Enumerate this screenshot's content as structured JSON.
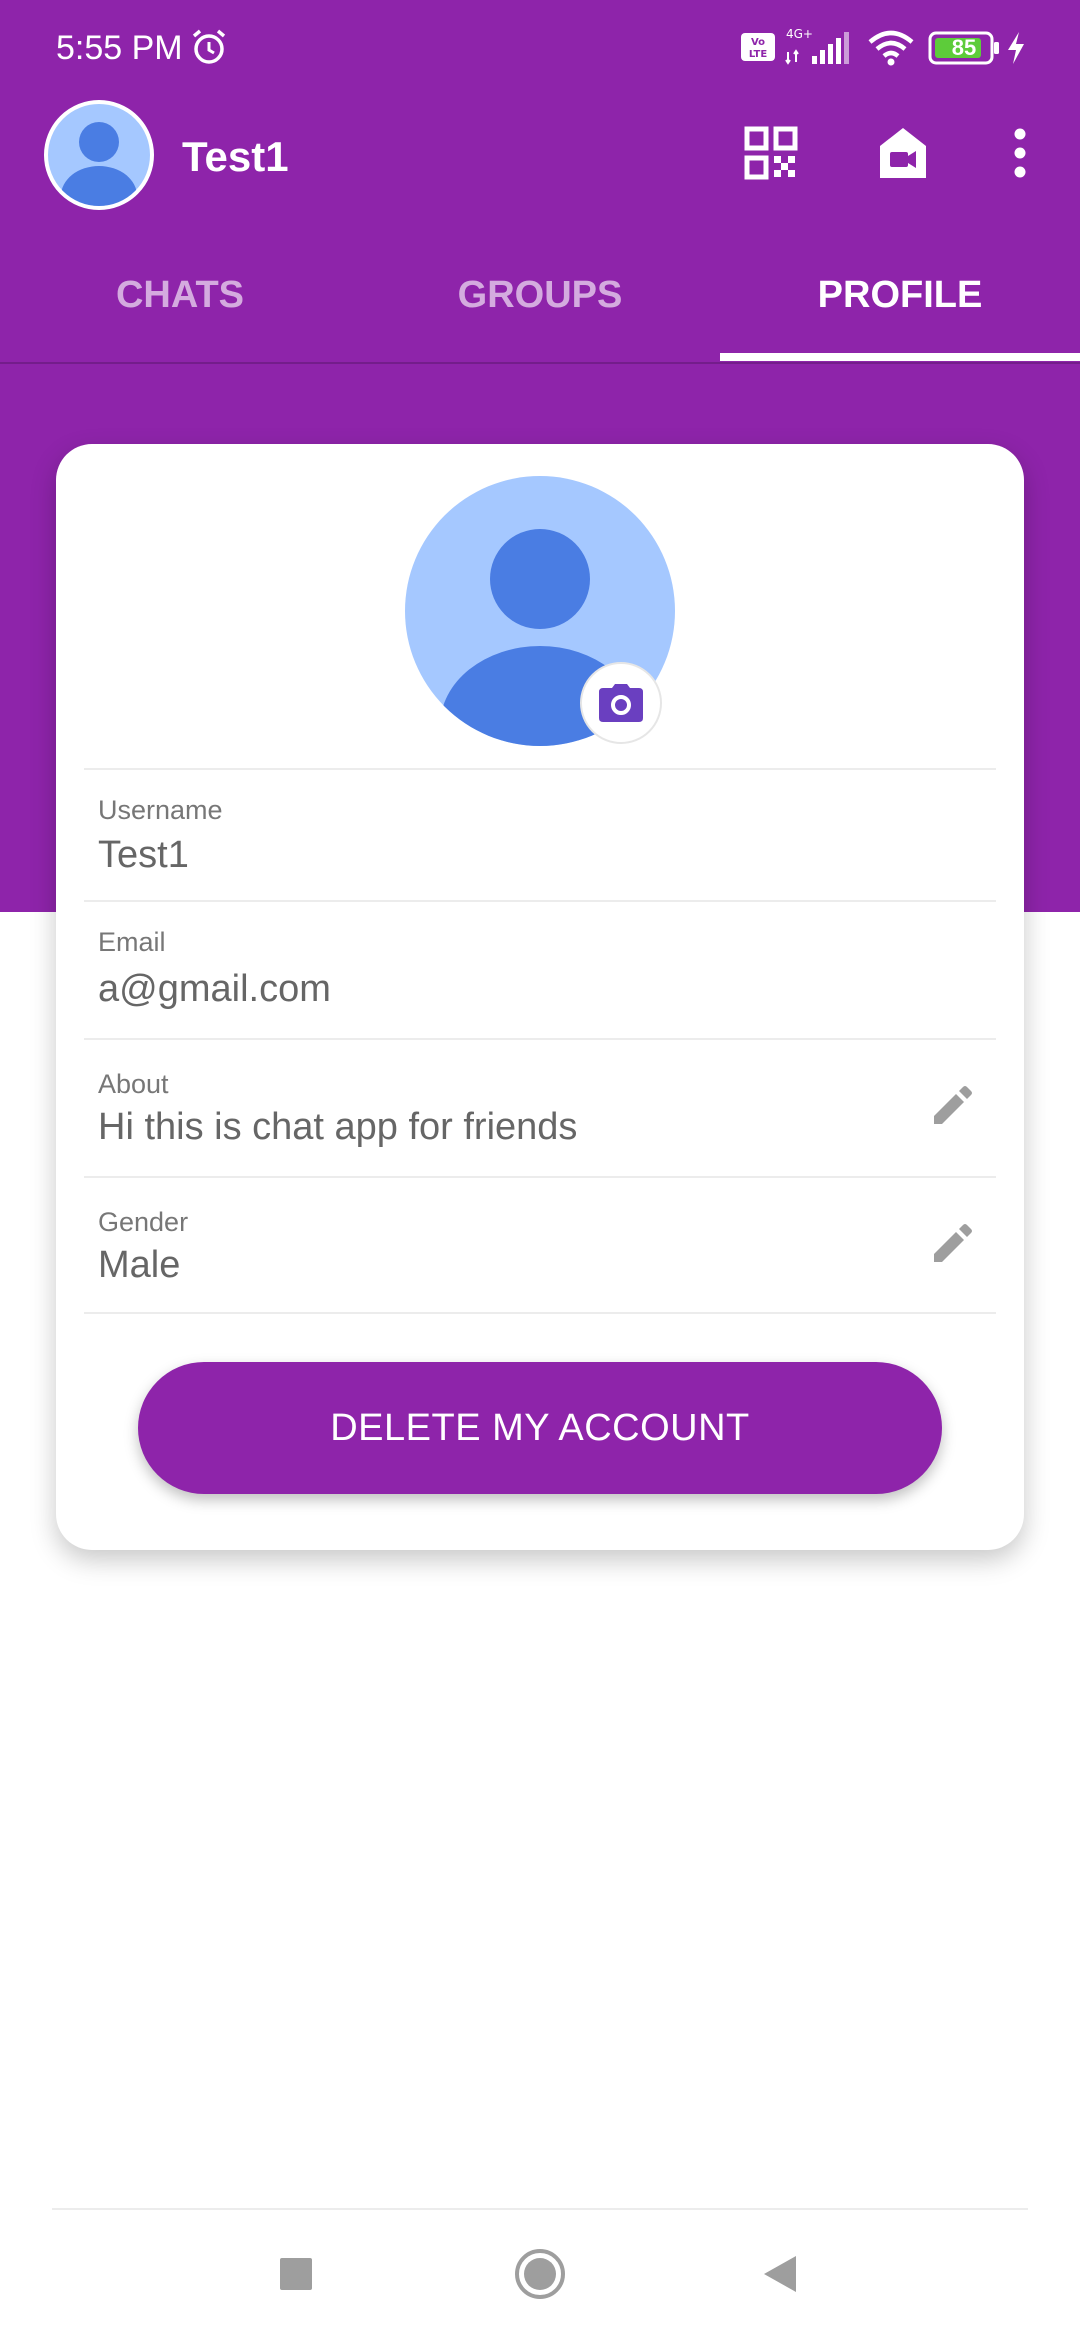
{
  "status_bar": {
    "time": "5:55 PM",
    "network": "4G+",
    "battery": "85"
  },
  "app_bar": {
    "title": "Test1",
    "icons": [
      "qr-code-icon",
      "video-home-icon",
      "more-vert-icon"
    ]
  },
  "tabs": [
    {
      "label": "CHATS",
      "active": false
    },
    {
      "label": "GROUPS",
      "active": false
    },
    {
      "label": "PROFILE",
      "active": true
    }
  ],
  "profile": {
    "fields": [
      {
        "label": "Username",
        "value": "Test1",
        "editable": false
      },
      {
        "label": "Email",
        "value": "a@gmail.com",
        "editable": false
      },
      {
        "label": "About",
        "value": "Hi this is chat app for friends",
        "editable": true
      },
      {
        "label": "Gender",
        "value": "Male",
        "editable": true
      }
    ],
    "delete_button": "DELETE MY ACCOUNT"
  },
  "colors": {
    "primary": "#8e24aa",
    "avatar_bg": "#a5c8ff",
    "avatar_fg": "#4a7de3",
    "camera_icon": "#6a3fc0"
  }
}
